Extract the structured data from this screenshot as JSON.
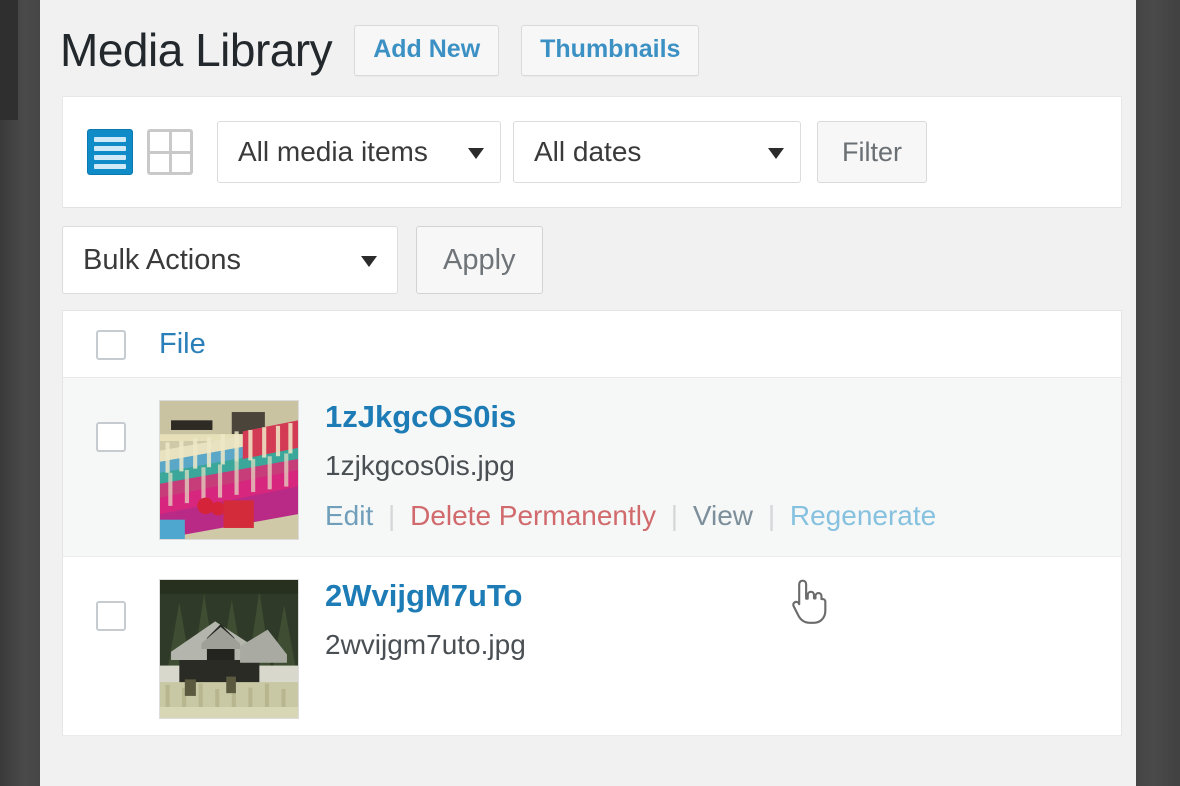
{
  "header": {
    "title": "Media Library",
    "actions": [
      {
        "label": "Add New",
        "name": "add-new-button"
      },
      {
        "label": "Thumbnails",
        "name": "thumbnails-button"
      }
    ]
  },
  "toolbar": {
    "view_list_label": "List view",
    "view_grid_label": "Grid view",
    "media_type_select": "All media items",
    "date_select": "All dates",
    "filter_label": "Filter"
  },
  "bulk": {
    "select_label": "Bulk Actions",
    "apply_label": "Apply"
  },
  "table": {
    "columns": [
      "File"
    ],
    "rows": [
      {
        "title": "1zJkgcOS0is",
        "filename": "1zjkgcos0is.jpg",
        "actions": [
          {
            "label": "Edit",
            "style": "act-edit"
          },
          {
            "label": "Delete Permanently",
            "style": "act-delete"
          },
          {
            "label": "View",
            "style": "act-view"
          },
          {
            "label": "Regenerate",
            "style": "act-regen"
          }
        ]
      },
      {
        "title": "2WvijgM7uTo",
        "filename": "2wvijgm7uto.jpg",
        "actions": []
      }
    ]
  },
  "colors": {
    "link_blue": "#1d7cb5",
    "delete_red": "#d06a6c",
    "active_view_blue": "#0f8bc8",
    "page_background": "#f1f1f1",
    "chrome_dark": "#434343"
  },
  "cursor": {
    "type": "pointer-hand",
    "over": "Regenerate"
  }
}
